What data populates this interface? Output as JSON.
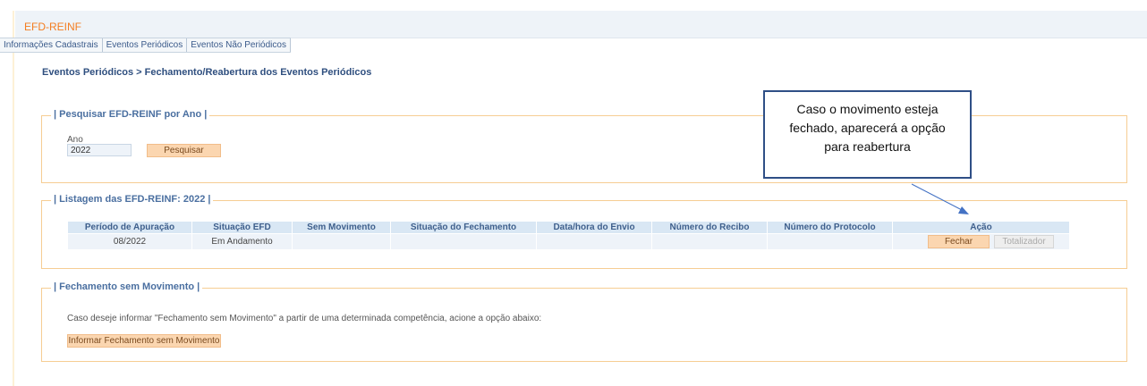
{
  "app": {
    "title": "EFD-REINF"
  },
  "tabs": [
    {
      "label": "Informações Cadastrais"
    },
    {
      "label": "Eventos Periódicos"
    },
    {
      "label": "Eventos Não Periódicos"
    }
  ],
  "breadcrumb": "Eventos Periódicos > Fechamento/Reabertura dos Eventos Periódicos",
  "search": {
    "legend": "| Pesquisar EFD-REINF por Ano |",
    "year_label": "Ano",
    "year_value": "2022",
    "button": "Pesquisar"
  },
  "listing": {
    "legend": "| Listagem das EFD-REINF: 2022 |",
    "columns": [
      "Período de Apuração",
      "Situação EFD",
      "Sem Movimento",
      "Situação do Fechamento",
      "Data/hora do Envio",
      "Número do Recibo",
      "Número do Protocolo",
      "Ação"
    ],
    "rows": [
      {
        "periodo": "08/2022",
        "situacao": "Em Andamento",
        "sem_movimento": "",
        "situacao_fechamento": "",
        "data_envio": "",
        "recibo": "",
        "protocolo": "",
        "btn_fechar": "Fechar",
        "btn_totalizador": "Totalizador"
      }
    ]
  },
  "no_movement": {
    "legend": "| Fechamento sem Movimento |",
    "info": "Caso deseje informar \"Fechamento sem Movimento\" a partir de uma determinada competência, acione a opção abaixo:",
    "button": "Informar Fechamento sem Movimento"
  },
  "callout": {
    "lines": [
      "Caso o movimento esteja",
      "fechado, aparecerá a opção",
      "para reabertura"
    ]
  },
  "colors": {
    "accent": "#f47d20",
    "link_blue": "#3e5f8c",
    "fieldset_border": "#f6cd93",
    "button_bg": "#fbd6b0",
    "callout_border": "#2f4f86"
  }
}
